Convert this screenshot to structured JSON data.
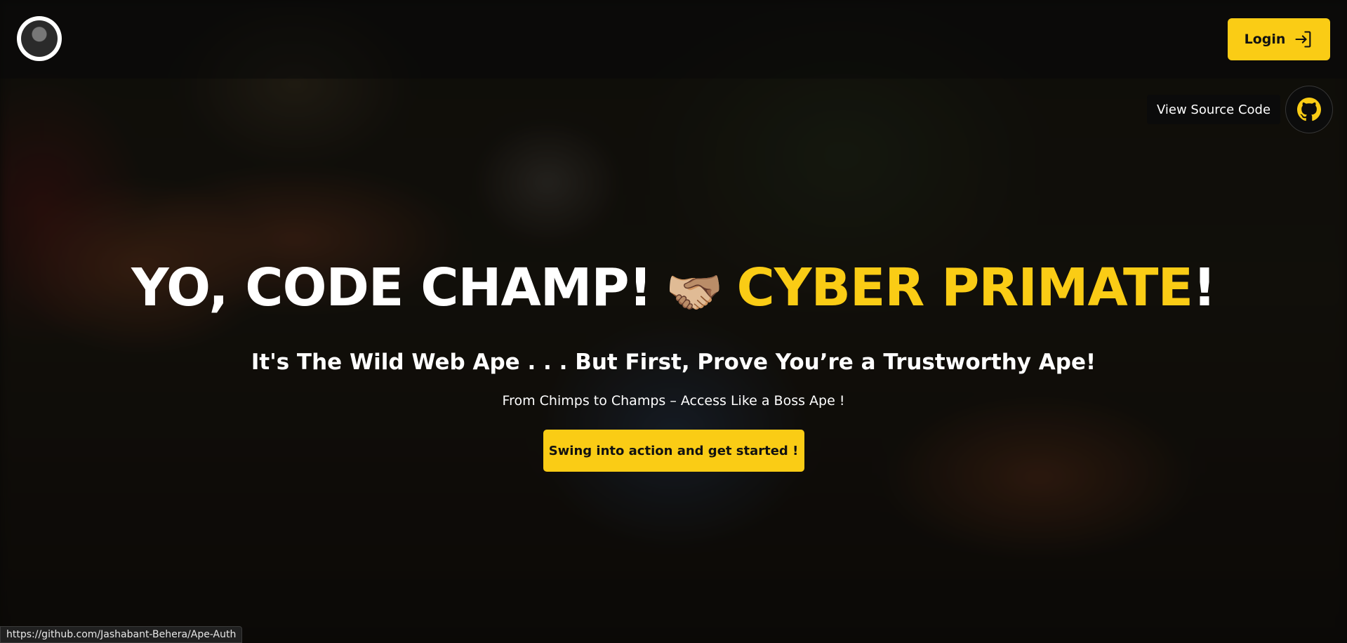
{
  "header": {
    "logo_alt": "Gorilla avatar logo",
    "login_label": "Login"
  },
  "source": {
    "tooltip": "View Source Code"
  },
  "hero": {
    "headline_part1": "YO, CODE CHAMP!",
    "headline_emoji": "🫱🏼‍🫲🏽",
    "headline_accent": "CYBER PRIMATE",
    "headline_end": "!",
    "subheadline": "It's The Wild Web Ape . . . But First, Prove You’re a Trustworthy Ape!",
    "tagline": "From Chimps to Champs – Access Like a Boss Ape !",
    "cta_label": "Swing into action and get started !"
  },
  "status_bar": {
    "url": "https://github.com/Jashabant-Behera/Ape-Auth"
  },
  "colors": {
    "accent": "#facc15",
    "text": "#ffffff",
    "background": "#0e0d0b"
  },
  "icons": {
    "login": "login-arrow-icon",
    "github": "github-icon",
    "emoji": "handshake-emoji"
  }
}
